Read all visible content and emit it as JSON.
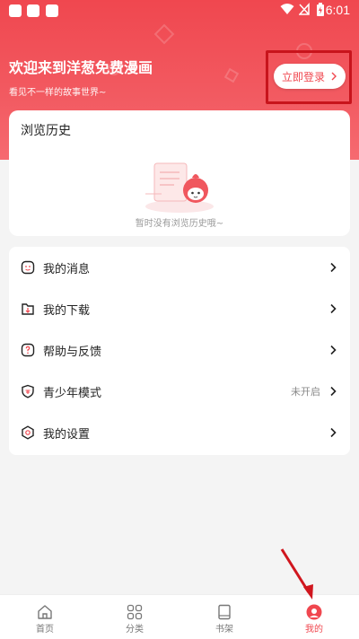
{
  "status_bar": {
    "time": "6:01"
  },
  "header": {
    "welcome_title": "欢迎来到洋葱免费漫画",
    "welcome_subtitle": "看见不一样的故事世界~",
    "login_button": "立即登录"
  },
  "history": {
    "title": "浏览历史",
    "empty_text": "暂时没有浏览历史哦~"
  },
  "menu": {
    "items": [
      {
        "label": "我的消息",
        "icon": "message-icon",
        "value": ""
      },
      {
        "label": "我的下载",
        "icon": "download-icon",
        "value": ""
      },
      {
        "label": "帮助与反馈",
        "icon": "help-icon",
        "value": ""
      },
      {
        "label": "青少年模式",
        "icon": "shield-icon",
        "value": "未开启"
      },
      {
        "label": "我的设置",
        "icon": "settings-icon",
        "value": ""
      }
    ]
  },
  "tabbar": {
    "items": [
      {
        "label": "首页",
        "icon": "home-icon"
      },
      {
        "label": "分类",
        "icon": "category-icon"
      },
      {
        "label": "书架",
        "icon": "bookshelf-icon"
      },
      {
        "label": "我的",
        "icon": "profile-icon",
        "active": true
      }
    ]
  },
  "colors": {
    "accent": "#f0474f",
    "highlight_box": "#c8141c"
  }
}
